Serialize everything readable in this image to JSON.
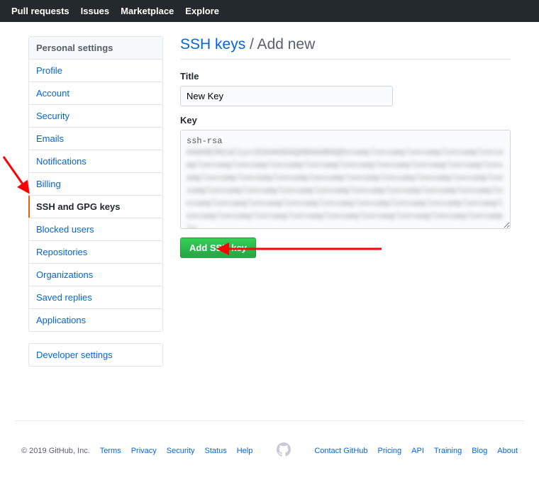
{
  "topnav": [
    "Pull requests",
    "Issues",
    "Marketplace",
    "Explore"
  ],
  "sidebar": {
    "header": "Personal settings",
    "items": [
      "Profile",
      "Account",
      "Security",
      "Emails",
      "Notifications",
      "Billing",
      "SSH and GPG keys",
      "Blocked users",
      "Repositories",
      "Organizations",
      "Saved replies",
      "Applications"
    ],
    "selected_index": 6,
    "dev_settings": "Developer settings"
  },
  "page": {
    "breadcrumb_link": "SSH keys",
    "breadcrumb_rest": "/ Add new",
    "title_label": "Title",
    "title_value": "New Key",
    "key_label": "Key",
    "key_value": "ssh-rsa",
    "submit_label": "Add SSH key"
  },
  "footer": {
    "copyright": "© 2019 GitHub, Inc.",
    "left": [
      "Terms",
      "Privacy",
      "Security",
      "Status",
      "Help"
    ],
    "right": [
      "Contact GitHub",
      "Pricing",
      "API",
      "Training",
      "Blog",
      "About"
    ]
  }
}
